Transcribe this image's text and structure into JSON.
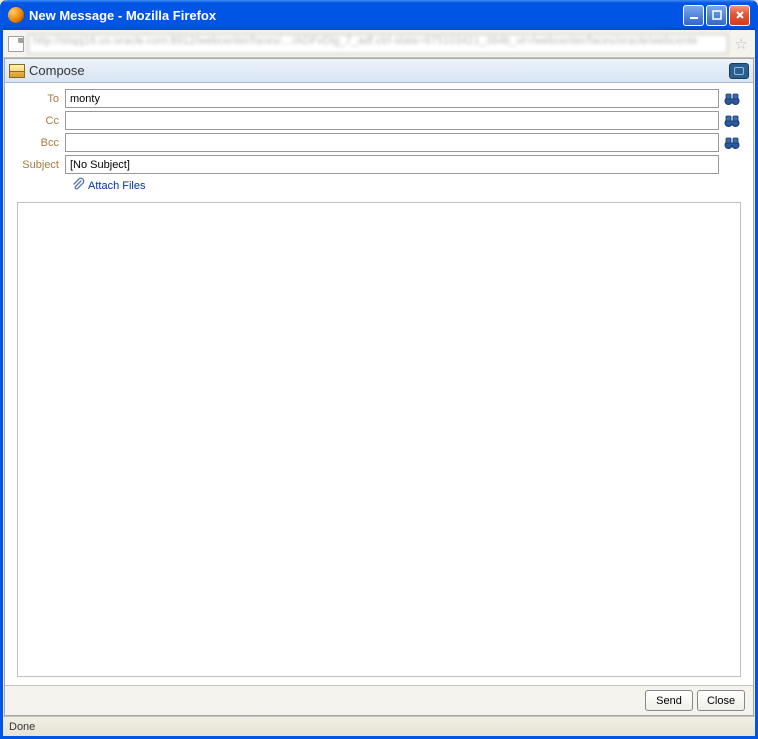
{
  "window": {
    "title": "New Message - Mozilla Firefox",
    "addressbar": "http://stapj16.us.oracle.com:8912/webcenter/faces/…/ADFvDlg_7_adf.ctrl-state=675103421_384b_vt=/webcenter/faces/oracle/webcente"
  },
  "compose": {
    "title": "Compose"
  },
  "fields": {
    "to_label": "To",
    "to_value": "monty",
    "cc_label": "Cc",
    "cc_value": "",
    "bcc_label": "Bcc",
    "bcc_value": "",
    "subject_label": "Subject",
    "subject_value": "[No Subject]"
  },
  "attach": {
    "label": "Attach Files"
  },
  "buttons": {
    "send": "Send",
    "close": "Close"
  },
  "status": {
    "text": "Done"
  }
}
